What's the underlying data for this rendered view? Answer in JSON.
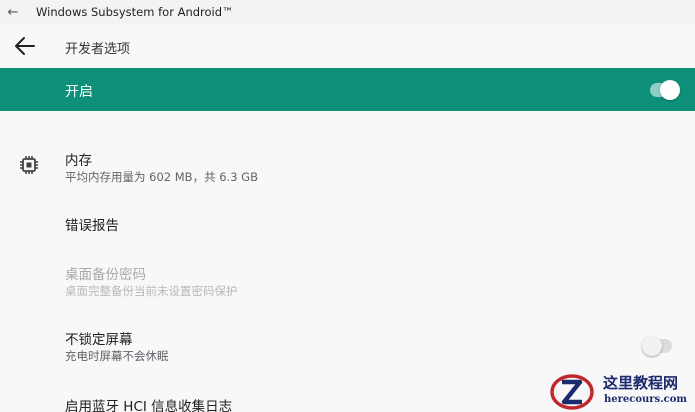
{
  "window": {
    "title": "Windows Subsystem for Android™",
    "back_glyph": "←"
  },
  "appbar": {
    "title": "开发者选项"
  },
  "master_toggle": {
    "label": "开启",
    "state": "on"
  },
  "settings": [
    {
      "title": "内存",
      "summary": "平均内存用量为 602 MB，共 6.3 GB",
      "icon": "chip-icon"
    },
    {
      "title": "错误报告"
    },
    {
      "title": "桌面备份密码",
      "summary": "桌面完整备份当前未设置密码保护",
      "disabled": true
    },
    {
      "title": "不锁定屏幕",
      "summary": "充电时屏幕不会休眠",
      "toggle": "off"
    },
    {
      "title": "启用蓝牙 HCI 信息收集日志"
    }
  ],
  "watermark": {
    "brand": "这里教程网",
    "domain": "herecours.com"
  },
  "colors": {
    "accent": "#0d8f7a",
    "background": "#f8f8f8"
  }
}
